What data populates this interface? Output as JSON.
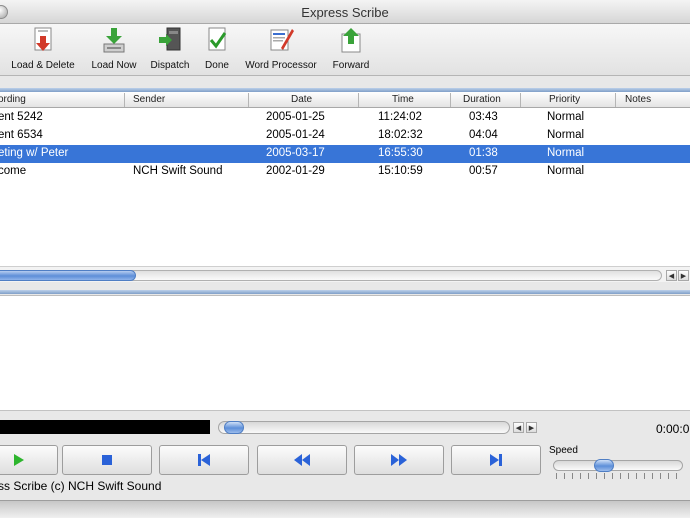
{
  "window": {
    "title": "Express Scribe"
  },
  "toolbar": {
    "buttons": [
      {
        "label": "Load & Delete",
        "icon": "load-delete-icon"
      },
      {
        "label": "Load Now",
        "icon": "load-now-icon"
      },
      {
        "label": "Dispatch",
        "icon": "dispatch-icon"
      },
      {
        "label": "Done",
        "icon": "done-icon"
      },
      {
        "label": "Word Processor",
        "icon": "word-processor-icon"
      },
      {
        "label": "Forward",
        "icon": "forward-icon"
      }
    ]
  },
  "table": {
    "columns": [
      "ording",
      "Sender",
      "Date",
      "Time",
      "Duration",
      "Priority",
      "Notes"
    ],
    "rows": [
      {
        "recording": "ent 5242",
        "sender": "",
        "date": "2005-01-25",
        "time": "11:24:02",
        "duration": "03:43",
        "priority": "Normal",
        "notes": "",
        "selected": false
      },
      {
        "recording": "ent 6534",
        "sender": "",
        "date": "2005-01-24",
        "time": "18:02:32",
        "duration": "04:04",
        "priority": "Normal",
        "notes": "",
        "selected": false
      },
      {
        "recording": "eting w/ Peter",
        "sender": "",
        "date": "2005-03-17",
        "time": "16:55:30",
        "duration": "01:38",
        "priority": "Normal",
        "notes": "",
        "selected": true
      },
      {
        "recording": "come",
        "sender": "NCH Swift Sound",
        "date": "2002-01-29",
        "time": "15:10:59",
        "duration": "00:57",
        "priority": "Normal",
        "notes": "",
        "selected": false
      }
    ]
  },
  "player": {
    "time": "0:00:0",
    "speed_label": "Speed",
    "buttons": [
      {
        "name": "play",
        "icon": "play-icon"
      },
      {
        "name": "stop",
        "icon": "stop-icon"
      },
      {
        "name": "skip-back",
        "icon": "skip-to-start-icon"
      },
      {
        "name": "rewind",
        "icon": "rewind-icon"
      },
      {
        "name": "fast-forward",
        "icon": "fast-forward-icon"
      },
      {
        "name": "skip-forward",
        "icon": "skip-to-end-icon"
      }
    ]
  },
  "status_bar": {
    "text": "ss Scribe (c) NCH Swift Sound"
  },
  "colors": {
    "selection": "#3875d7",
    "accent": "#5c8fd9",
    "play_green": "#2db52d",
    "control_blue": "#2a62d8"
  }
}
